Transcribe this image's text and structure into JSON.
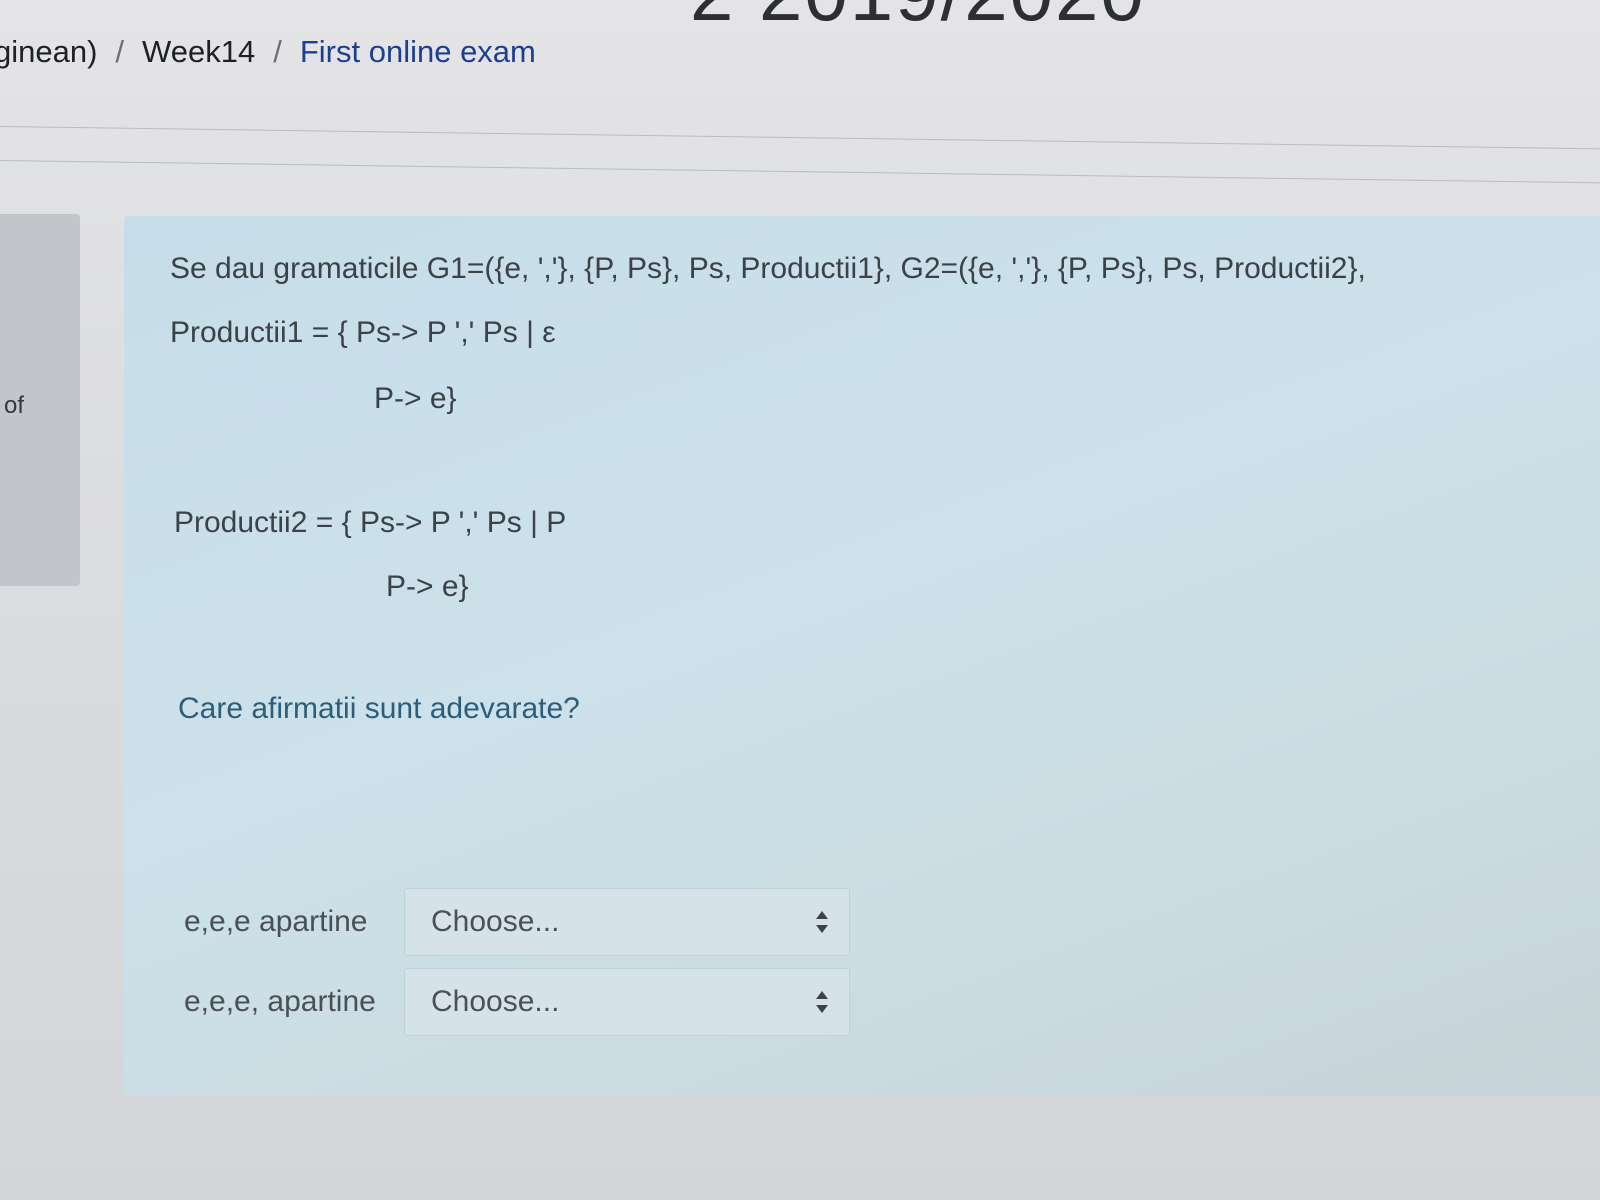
{
  "header": {
    "course_title_fragment": "2 2019/2020"
  },
  "breadcrumb": {
    "items": [
      "ginean)",
      "Week14",
      "First online exam"
    ],
    "separator": "/"
  },
  "info_panel": {
    "text": "of"
  },
  "question": {
    "intro": "Se dau gramaticile G1=({e, ','}, {P, Ps}, Ps, Productii1}, G2=({e, ','}, {P, Ps}, Ps, Productii2},",
    "productii1_line1": "Productii1 = { Ps-> P ',' Ps | ε",
    "productii1_line2": "P-> e}",
    "productii2_line1": "Productii2 = { Ps-> P ',' Ps | P",
    "productii2_line2": "P-> e}",
    "prompt": "Care afirmatii sunt adevarate?"
  },
  "answers": [
    {
      "label": "e,e,e apartine",
      "select_value": "Choose..."
    },
    {
      "label": "e,e,e, apartine",
      "select_value": "Choose..."
    }
  ],
  "icons": {
    "select_arrows": "up-down-arrows-icon"
  },
  "colors": {
    "question_background": "#c6dde9",
    "breadcrumb_link": "#1d3f8f",
    "prompt_text": "#2e5d7a"
  }
}
